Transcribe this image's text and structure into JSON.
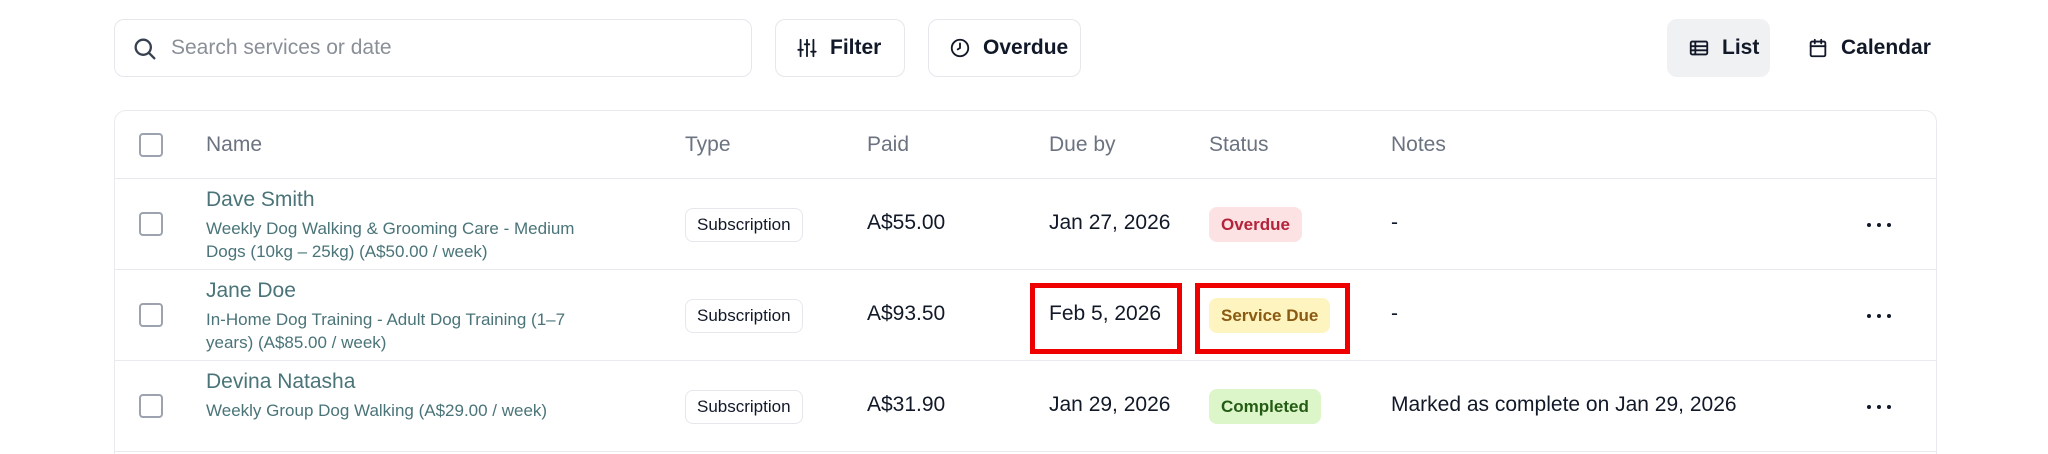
{
  "toolbar": {
    "search": {
      "placeholder": "Search services or date",
      "value": "",
      "icon": "search-icon"
    },
    "filter_label": "Filter",
    "overdue_label": "Overdue",
    "view_list_label": "List",
    "view_calendar_label": "Calendar",
    "active_view": "List"
  },
  "table": {
    "columns": [
      "Name",
      "Type",
      "Paid",
      "Due by",
      "Status",
      "Notes"
    ],
    "rows": [
      {
        "name": "Dave Smith",
        "service": "Weekly Dog Walking & Grooming Care - Medium Dogs (10kg – 25kg) (A$50.00 / week)",
        "type": "Subscription",
        "paid": "A$55.00",
        "due_by": "Jan 27, 2026",
        "status": "Overdue",
        "notes": "-"
      },
      {
        "name": "Jane Doe",
        "service": "In-Home Dog Training - Adult Dog Training (1–7 years) (A$85.00 / week)",
        "type": "Subscription",
        "paid": "A$93.50",
        "due_by": "Feb 5, 2026",
        "status": "Service Due",
        "notes": "-"
      },
      {
        "name": "Devina Natasha",
        "service": "Weekly Group Dog Walking (A$29.00 / week)",
        "type": "Subscription",
        "paid": "A$31.90",
        "due_by": "Jan 29, 2026",
        "status": "Completed",
        "notes": "Marked as complete on Jan 29, 2026"
      }
    ]
  },
  "colors": {
    "highlight": "#ee0000",
    "status_overdue_bg": "#fde2e4",
    "status_service_due_bg": "#fdf4bf",
    "status_completed_bg": "#dcf5c9",
    "name_text": "#4a7478"
  }
}
